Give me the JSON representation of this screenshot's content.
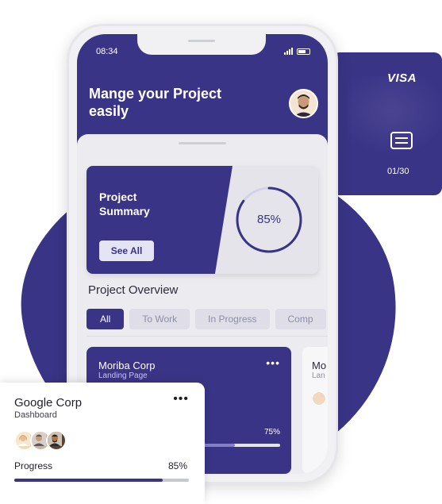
{
  "colors": {
    "primary": "#3a3487",
    "light": "#e5e4f3"
  },
  "visa_card": {
    "logo": "VISA",
    "expiry": "01/30",
    "icon": "chip-icon"
  },
  "status_bar": {
    "time": "08:34"
  },
  "header": {
    "title": "Mange your Project easily"
  },
  "summary": {
    "title": "Project Summary",
    "button": "See All",
    "percent_label": "85%",
    "percent": 0.85
  },
  "overview": {
    "title": "Project Overview",
    "tabs": [
      "All",
      "To Work",
      "In Progress",
      "Comp"
    ]
  },
  "project_cards": [
    {
      "title": "Moriba Corp",
      "subtitle": "Landing Page",
      "percent_label": "75%",
      "percent": 0.75
    },
    {
      "title": "Mo",
      "subtitle": "Lan"
    }
  ],
  "google_card": {
    "title": "Google Corp",
    "subtitle": "Dashboard",
    "progress_label": "Progress",
    "percent_label": "85%",
    "percent": 0.85
  }
}
